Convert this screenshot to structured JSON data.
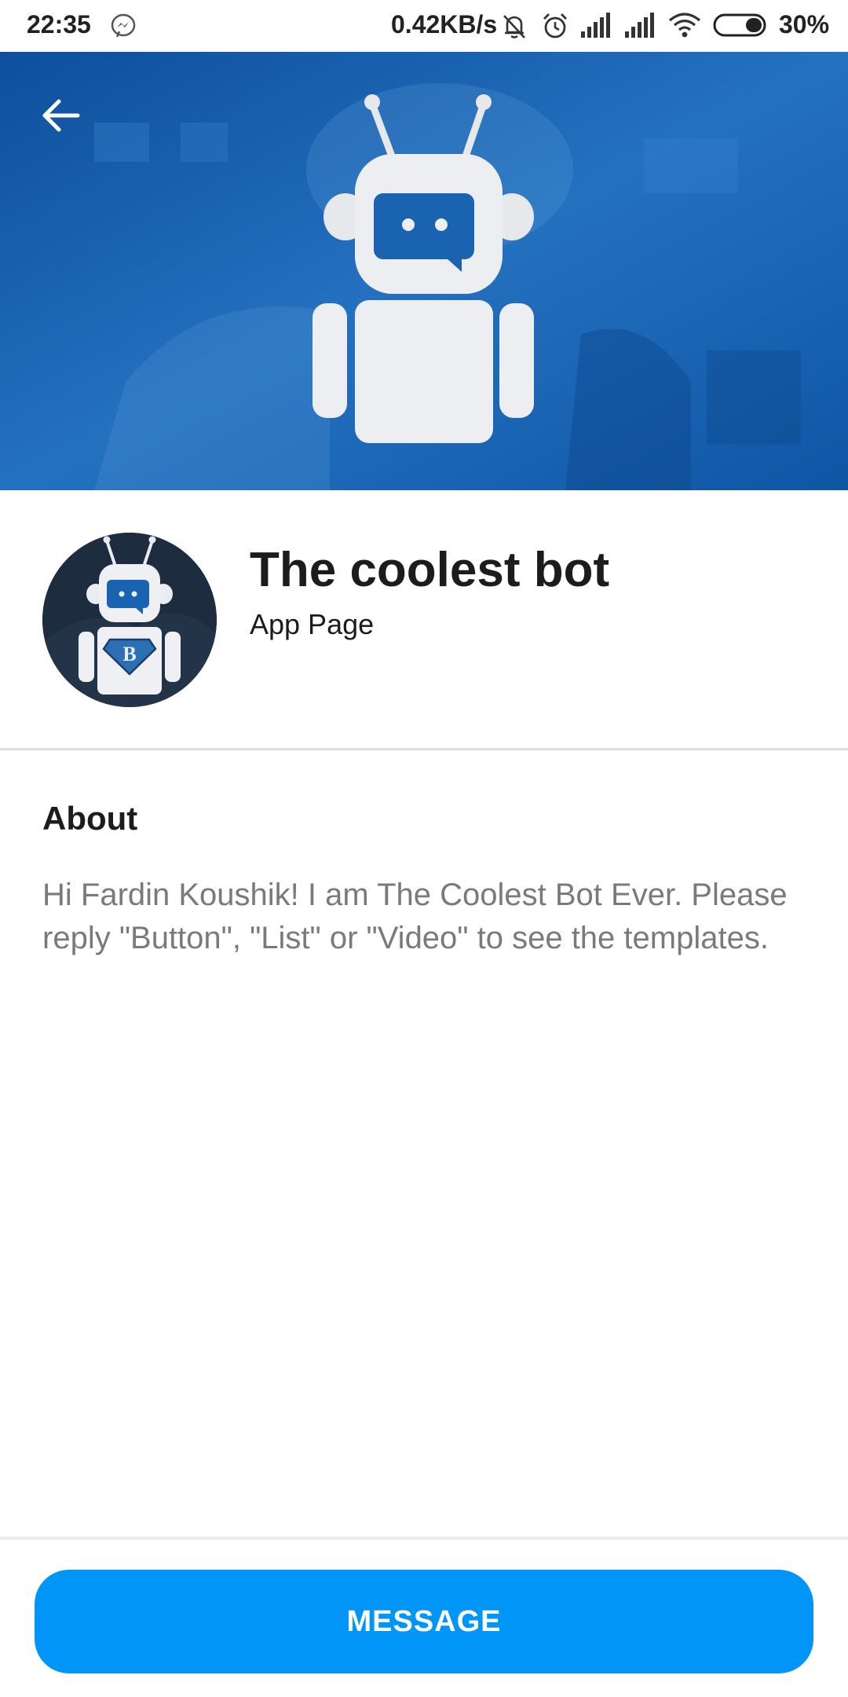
{
  "status_bar": {
    "time": "22:35",
    "network_speed": "0.42KB/s",
    "battery_percent": "30%",
    "icons": [
      "messenger-icon",
      "mute-icon",
      "alarm-icon",
      "signal-icon",
      "signal-icon",
      "wifi-icon",
      "battery-icon"
    ]
  },
  "header": {
    "back_icon": "back-arrow-icon"
  },
  "profile": {
    "name": "The coolest bot",
    "category": "App Page"
  },
  "about": {
    "heading": "About",
    "description": "Hi Fardin Koushik! I am The Coolest Bot Ever. Please reply \"Button\", \"List\" or \"Video\" to see the templates."
  },
  "bottom": {
    "message_label": "MESSAGE"
  },
  "colors": {
    "cover_blue": "#1a63b0",
    "button_blue": "#0295f8",
    "avatar_bg": "#1e2c40",
    "text_dark": "#1c1c1c",
    "text_gray": "#7a7a7a"
  }
}
